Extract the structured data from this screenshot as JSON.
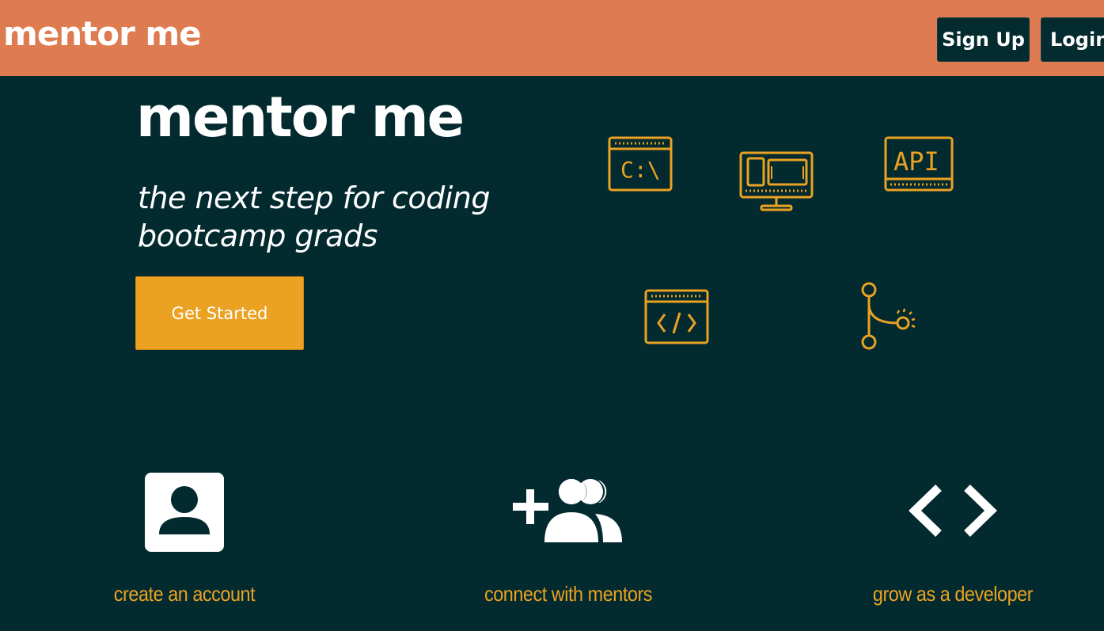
{
  "header": {
    "brand": "mentor me",
    "signup_label": "Sign Up",
    "login_label": "Login"
  },
  "hero": {
    "title": "mentor me",
    "tagline": "the next step for coding bootcamp grads",
    "cta_label": "Get Started",
    "icons": {
      "terminal_text": "C:\\",
      "api_text": "API"
    }
  },
  "features": [
    {
      "label": "create an account",
      "icon": "account-box-icon"
    },
    {
      "label": "connect with mentors",
      "icon": "add-group-icon"
    },
    {
      "label": "grow as a developer",
      "icon": "code-brackets-icon"
    }
  ],
  "colors": {
    "header_bg": "#de7b51",
    "page_bg": "#022a2f",
    "accent": "#eba223",
    "text": "#ffffff"
  }
}
